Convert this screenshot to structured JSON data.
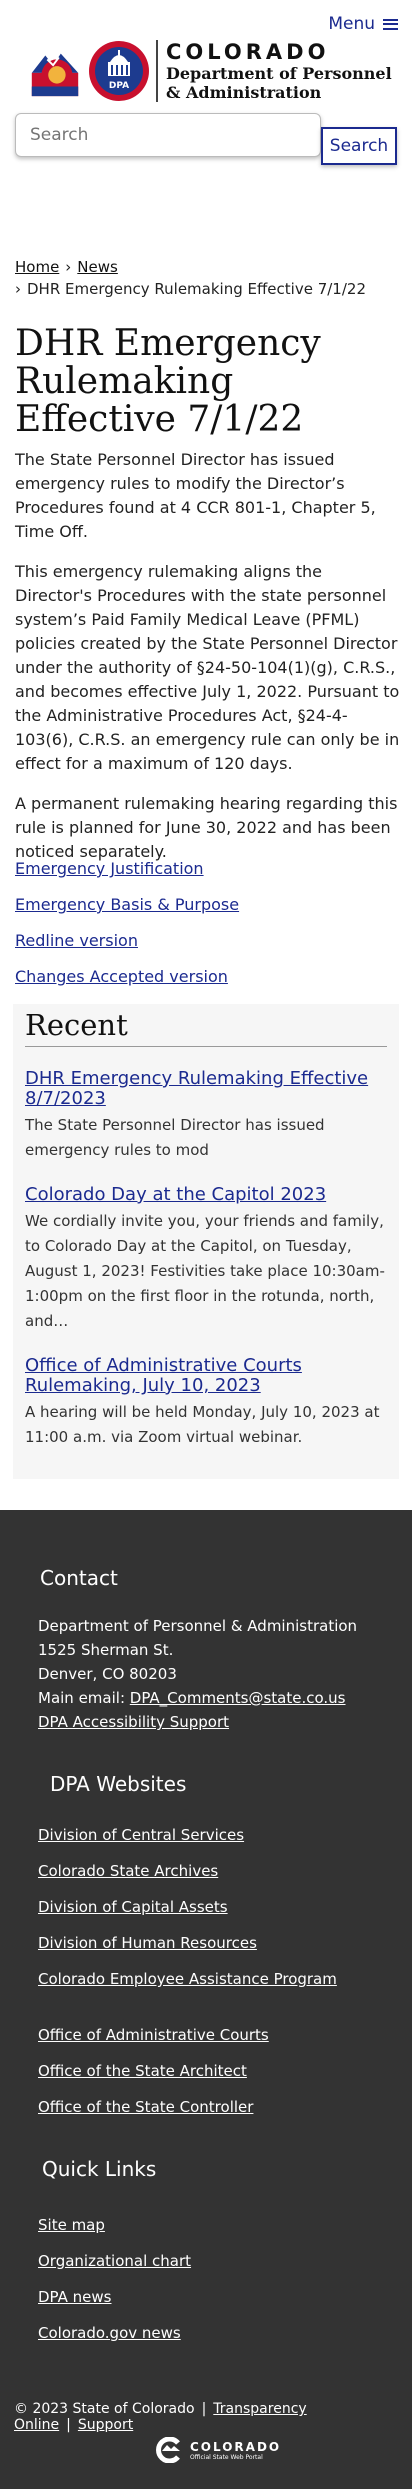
{
  "header": {
    "menu_label": "Menu",
    "brand_state": "COLORADO",
    "brand_dept_line1": "Department of Personnel",
    "brand_dept_line2": "& Administration",
    "dpa_badge": "DPA"
  },
  "search": {
    "placeholder": "Search",
    "button_label": "Search"
  },
  "breadcrumb": {
    "home": "Home",
    "news": "News",
    "current": "DHR Emergency Rulemaking Effective 7/1/22"
  },
  "page": {
    "title": "DHR Emergency Rulemaking Effective 7/1/22",
    "paragraphs": [
      "The State Personnel Director has issued emergency rules to modify the Director’s Procedures found at 4 CCR 801-1, Chapter 5, Time Off.",
      "This emergency rulemaking aligns the Director's Procedures with the state personnel system’s Paid Family Medical Leave (PFML) policies created by the State Personnel Director under the authority of §24-50-104(1)(g), C.R.S., and becomes effective July 1, 2022.  Pursuant to the Administrative Procedures Act, §24-4-103(6), C.R.S. an emergency rule can only be in effect for a maximum of 120 days.",
      "A permanent rulemaking hearing regarding this rule is planned for June 30, 2022 and has been noticed separately."
    ],
    "links": [
      "Emergency Justification",
      "Emergency Basis & Purpose",
      "Redline version",
      "Changes Accepted version"
    ]
  },
  "recent": {
    "heading": "Recent",
    "items": [
      {
        "title": "DHR Emergency Rulemaking Effective 8/7/2023",
        "summary": "The State Personnel Director has issued emergency rules to mod"
      },
      {
        "title": "Colorado Day at the Capitol 2023",
        "summary": "We cordially invite you, your friends and family, to Colorado Day at the Capitol, on Tuesday, August 1, 2023!  Festivities take place 10:30am-1:00pm on the first floor in the rotunda, north, and…"
      },
      {
        "title": "Office of Administrative Courts Rulemaking, July 10, 2023",
        "summary": "A hearing will be held Monday, July 10, 2023 at 11:00 a.m. via Zoom virtual webinar."
      }
    ]
  },
  "footer": {
    "contact_heading": "Contact",
    "contact_org": "Department of Personnel & Administration",
    "contact_street": "1525 Sherman St.",
    "contact_city": "Denver, CO 80203",
    "contact_email_label": "Main email:",
    "contact_email": "DPA_Comments@state.co.us",
    "accessibility": "DPA Accessibility Support",
    "websites_heading": "DPA Websites",
    "websites_group1": [
      "Division of Central Services",
      "Colorado State Archives",
      "Division of Capital Assets",
      "Division of Human Resources",
      "Colorado Employee Assistance Program"
    ],
    "websites_group2": [
      "Office of Administrative Courts",
      "Office of the State Architect",
      "Office of the State Controller"
    ],
    "quick_heading": "Quick Links",
    "quick_links": [
      "Site map",
      "Organizational chart",
      "DPA news",
      "Colorado.gov news"
    ],
    "copyright": "© 2023 State of Colorado",
    "transparency": "Transparency Online",
    "support": "Support",
    "portal_name": "COLORADO",
    "portal_sub": "Official State Web Portal"
  },
  "colors": {
    "link": "#1b2a8f",
    "footer_bg": "#333333",
    "recent_bg": "#f6f6f6",
    "co_blue": "#1d3b8f",
    "co_red": "#c8102e",
    "co_gold": "#f2b33d"
  }
}
